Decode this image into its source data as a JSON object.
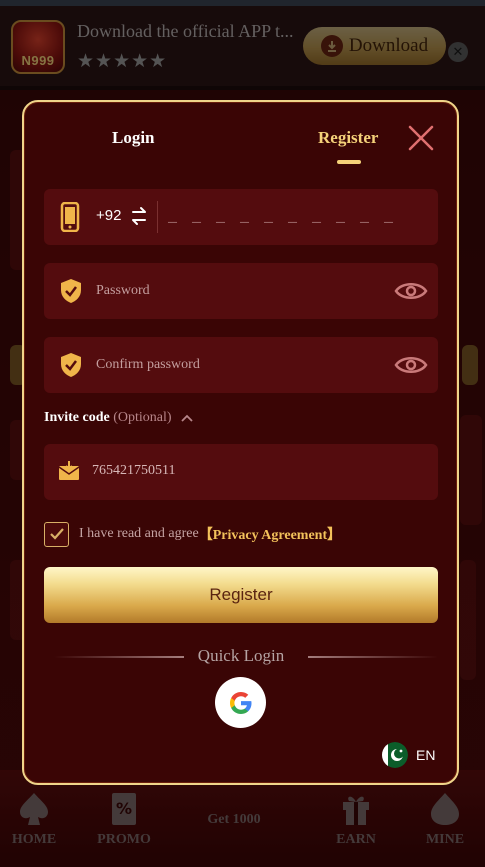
{
  "banner": {
    "title": "Download the official APP t...",
    "logo_text": "N999",
    "stars": "★★★★★",
    "download_label": "Download",
    "close_glyph": "✕"
  },
  "tabs": {
    "login": "Login",
    "register": "Register"
  },
  "phone": {
    "country_code": "+92",
    "placeholder": "_ _ _ _ _ _ _ _ _ _"
  },
  "password": {
    "placeholder": "Password"
  },
  "confirm_password": {
    "placeholder": "Confirm password"
  },
  "invite": {
    "label": "Invite code",
    "optional": "(Optional)",
    "value": "765421750511"
  },
  "agreement": {
    "text": "I have read and agree",
    "link": "【Privacy Agreement】",
    "checked": true
  },
  "register_button": "Register",
  "quick_login": "Quick Login",
  "language": "EN",
  "bottom_nav": {
    "home": "HOME",
    "promo": "PROMO",
    "get": "Get 1000",
    "earn": "EARN",
    "mine": "MINE"
  },
  "colors": {
    "accent": "#f5d27a",
    "modal_bg": "#3a0505",
    "field_bg": "#540c0e",
    "border": "#f0d58a"
  }
}
